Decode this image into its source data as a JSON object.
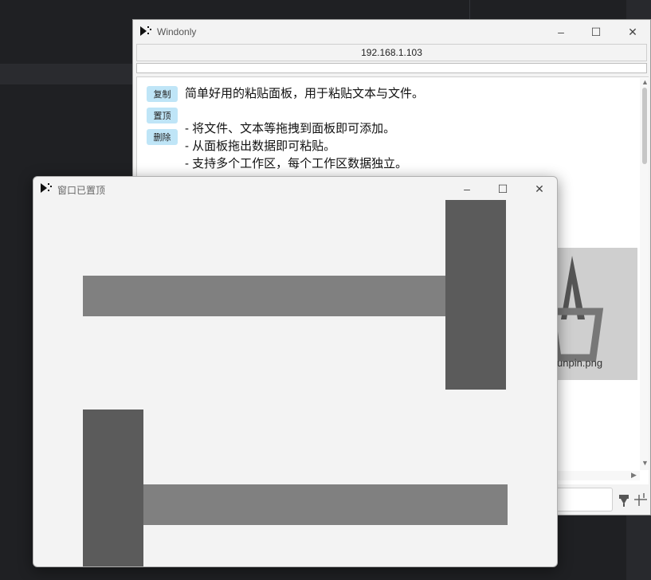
{
  "back_window": {
    "title": "Windonly",
    "address": "192.168.1.103",
    "buttons": {
      "copy": "复制",
      "pin": "置顶",
      "delete": "删除"
    },
    "text": {
      "line1": "简单好用的粘贴面板，用于粘贴文本与文件。",
      "line2": "- 将文件、文本等拖拽到面板即可添加。",
      "line3": "- 从面板拖出数据即可粘贴。",
      "line4": "- 支持多个工作区，每个工作区数据独立。"
    },
    "image_label": "unpin.png",
    "controls": {
      "minimize": "–",
      "maximize": "☐",
      "close": "✕"
    }
  },
  "front_window": {
    "title": "窗口已置顶",
    "controls": {
      "minimize": "–",
      "maximize": "☐",
      "close": "✕"
    }
  },
  "colors": {
    "desktop": "#1f2023",
    "window_bg": "#f3f3f3",
    "accent_button": "#bfe5f7",
    "icon_dark": "#5b5b5b",
    "icon_light": "#7f7f7f"
  }
}
